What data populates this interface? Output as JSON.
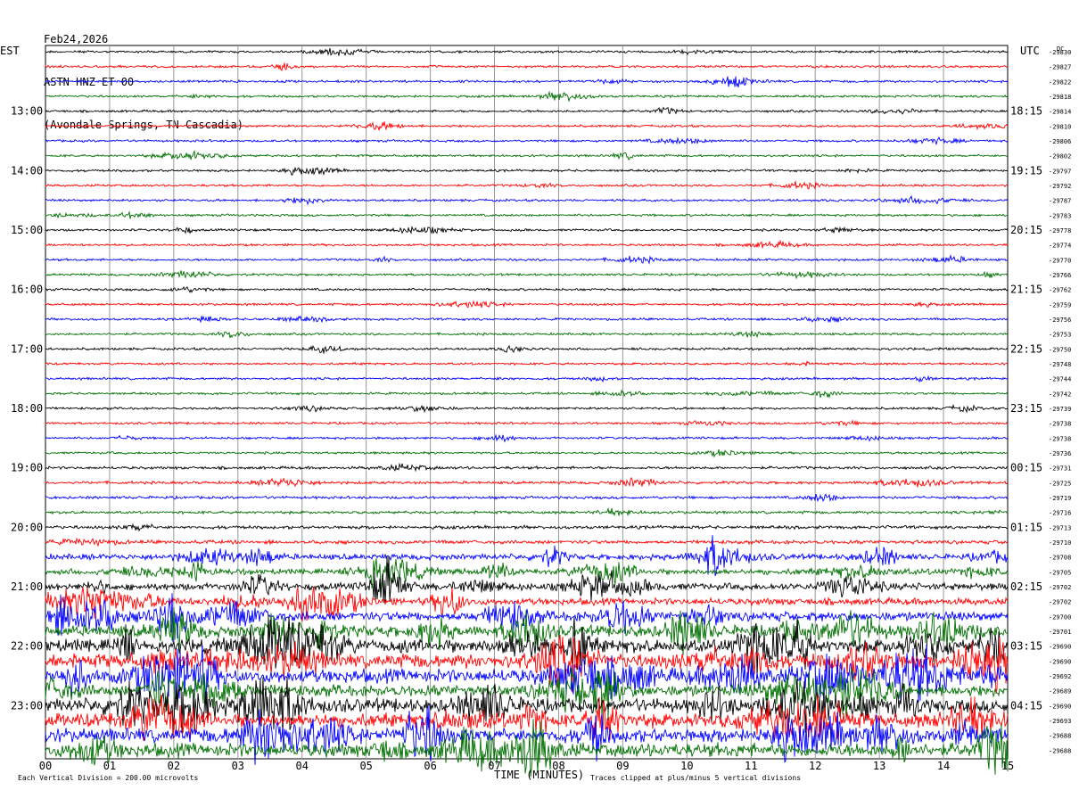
{
  "header": {
    "date": "Feb24,2026",
    "station": "ASTN HNZ ET 00",
    "location": "(Avondale Springs, TN Cascadia)"
  },
  "chart_data": {
    "type": "line",
    "title": "",
    "left_timezone": "EST",
    "right_timezone": "UTC",
    "dc_label": "DC",
    "xlabel": "TIME (MINUTES)",
    "x_ticks": [
      "00",
      "01",
      "02",
      "03",
      "04",
      "05",
      "06",
      "07",
      "08",
      "09",
      "10",
      "11",
      "12",
      "13",
      "14",
      "15"
    ],
    "xlim": [
      0,
      15
    ],
    "left_hour_labels": [
      "13:00",
      "14:00",
      "15:00",
      "16:00",
      "17:00",
      "18:00",
      "19:00",
      "20:00",
      "21:00",
      "22:00",
      "23:00"
    ],
    "right_hour_labels": [
      "18:15",
      "19:15",
      "20:15",
      "21:15",
      "22:15",
      "23:15",
      "00:15",
      "01:15",
      "02:15",
      "03:15",
      "04:15"
    ],
    "trace_colors": [
      "#000000",
      "#ff0000",
      "#0000ff",
      "#007000"
    ],
    "dc_offsets": [
      "-29830",
      "-29827",
      "-29822",
      "-29818",
      "-29814",
      "-29810",
      "-29806",
      "-29802",
      "-29797",
      "-29792",
      "-29787",
      "-29783",
      "-29778",
      "-29774",
      "-29770",
      "-29766",
      "-29762",
      "-29759",
      "-29756",
      "-29753",
      "-29750",
      "-29748",
      "-29744",
      "-29742",
      "-29739",
      "-29738",
      "-29738",
      "-29736",
      "-29731",
      "-29725",
      "-29719",
      "-29716",
      "-29713",
      "-29710",
      "-29708",
      "-29705",
      "-29702",
      "-29702",
      "-29700",
      "-29701",
      "-29690",
      "-29690",
      "-29692",
      "-29689",
      "-29690",
      "-29693",
      "-29688",
      "-29688"
    ],
    "activity": [
      1,
      1,
      1,
      1,
      1,
      1,
      1,
      1,
      1,
      1,
      1,
      1,
      1,
      1,
      1,
      1,
      1,
      1,
      1,
      1,
      1,
      1,
      1,
      1,
      1,
      1,
      1,
      1,
      1.2,
      1.2,
      1.2,
      1.2,
      1.4,
      1.6,
      2.5,
      2.5,
      3,
      3,
      4,
      5,
      6,
      6,
      6,
      5,
      6,
      6,
      6,
      6
    ],
    "footer_left": "Each Vertical Division =  200.00 microvolts",
    "footer_right": "Traces clipped at plus/minus 5 vertical divisions"
  }
}
